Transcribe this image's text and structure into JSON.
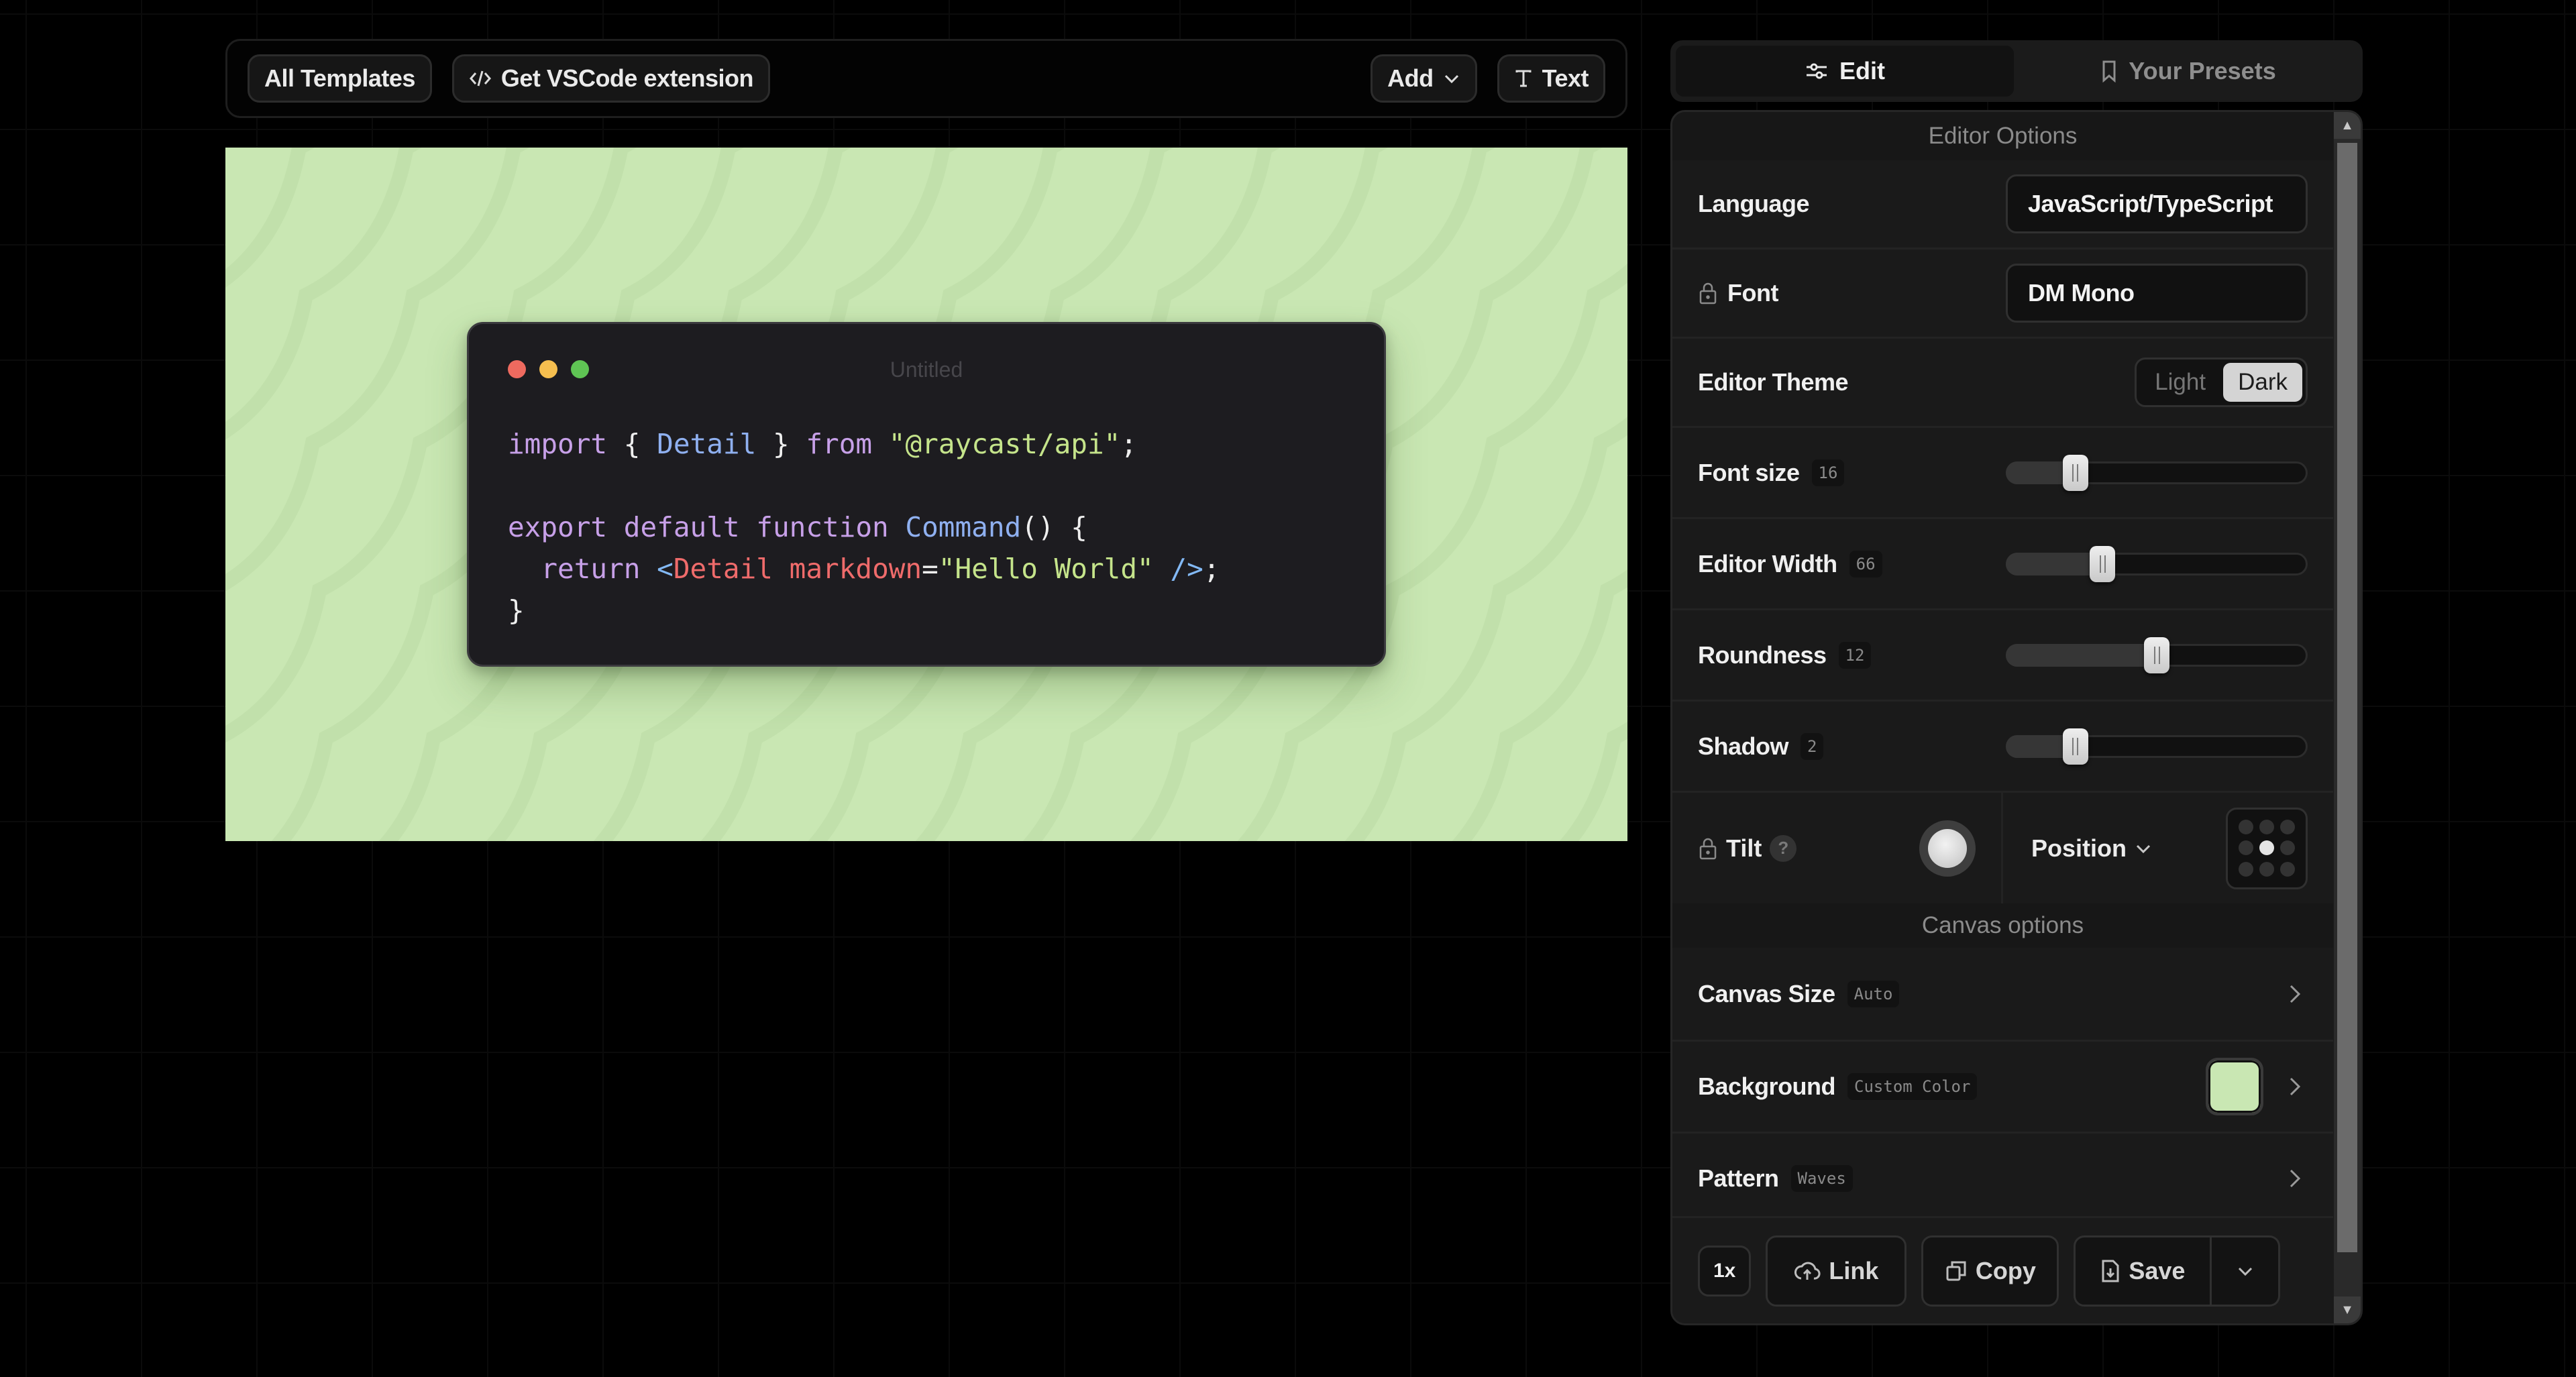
{
  "toolbar": {
    "all_templates": "All Templates",
    "vscode_extension": "Get VSCode extension",
    "add": "Add",
    "text": "Text"
  },
  "canvas": {
    "background_color": "#c9e7b3",
    "window_title": "Untitled",
    "traffic_lights": [
      "#ee6a5f",
      "#f5be4f",
      "#5fc454"
    ],
    "code_lines": [
      [
        [
          "kw",
          "import"
        ],
        [
          "punc",
          " { "
        ],
        [
          "id",
          "Detail"
        ],
        [
          "punc",
          " } "
        ],
        [
          "kw",
          "from"
        ],
        [
          "punc",
          " "
        ],
        [
          "str",
          "\"@raycast/api\""
        ],
        [
          "punc",
          ";"
        ]
      ],
      [],
      [
        [
          "kw",
          "export default function"
        ],
        [
          "punc",
          " "
        ],
        [
          "id",
          "Command"
        ],
        [
          "punc",
          "() {"
        ]
      ],
      [
        [
          "punc",
          "  "
        ],
        [
          "kw",
          "return"
        ],
        [
          "punc",
          " "
        ],
        [
          "op",
          "<"
        ],
        [
          "tag",
          "Detail markdown"
        ],
        [
          "punc",
          "="
        ],
        [
          "str",
          "\"Hello World\""
        ],
        [
          "punc",
          " "
        ],
        [
          "op",
          "/>"
        ],
        [
          "punc",
          ";"
        ]
      ],
      [
        [
          "punc",
          "}"
        ]
      ]
    ]
  },
  "tabs": {
    "edit": "Edit",
    "presets": "Your Presets",
    "active": "edit"
  },
  "editor_options": {
    "header": "Editor Options",
    "language_label": "Language",
    "language_value": "JavaScript/TypeScript",
    "font_label": "Font",
    "font_value": "DM Mono",
    "theme_label": "Editor Theme",
    "theme_options": [
      "Light",
      "Dark"
    ],
    "theme_selected": "Dark",
    "font_size": {
      "label": "Font size",
      "value": "16",
      "fraction": 0.23
    },
    "editor_width": {
      "label": "Editor Width",
      "value": "66",
      "fraction": 0.32
    },
    "roundness": {
      "label": "Roundness",
      "value": "12",
      "fraction": 0.5
    },
    "shadow": {
      "label": "Shadow",
      "value": "2",
      "fraction": 0.23
    },
    "tilt_label": "Tilt",
    "tilt_help": "?",
    "position_label": "Position",
    "position_selected": "center"
  },
  "canvas_options": {
    "header": "Canvas options",
    "canvas_size_label": "Canvas Size",
    "canvas_size_value": "Auto",
    "background_label": "Background",
    "background_value": "Custom Color",
    "background_swatch": "#c9e7b3",
    "pattern_label": "Pattern",
    "pattern_value": "Waves"
  },
  "footer": {
    "scale": "1x",
    "link": "Link",
    "copy": "Copy",
    "save": "Save"
  }
}
